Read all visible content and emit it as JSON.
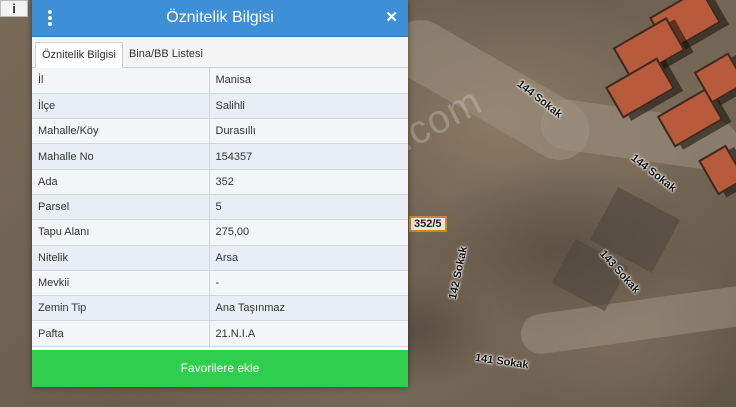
{
  "map": {
    "info_button_label": "i",
    "parcel_label": "352/5",
    "watermark": "emlakjet.com",
    "streets": [
      {
        "label": "144 Sokak"
      },
      {
        "label": "144 Sokak"
      },
      {
        "label": "143 Sokak"
      },
      {
        "label": "142 Sokak"
      },
      {
        "label": "141 Sokak"
      }
    ]
  },
  "dialog": {
    "title": "Öznitelik Bilgisi",
    "menu_icon": "kebab-menu-icon",
    "close_icon": "close-icon",
    "close_glyph": "✕",
    "tabs": [
      {
        "label": "Öznitelik Bilgisi",
        "active": true
      },
      {
        "label": "Bina/BB Listesi",
        "active": false
      }
    ],
    "rows": [
      {
        "key": "İl",
        "value": "Manisa"
      },
      {
        "key": "İlçe",
        "value": "Salihli"
      },
      {
        "key": "Mahalle/Köy",
        "value": "Durasıllı"
      },
      {
        "key": "Mahalle No",
        "value": "154357"
      },
      {
        "key": "Ada",
        "value": "352"
      },
      {
        "key": "Parsel",
        "value": "5"
      },
      {
        "key": "Tapu Alanı",
        "value": "275,00"
      },
      {
        "key": "Nitelik",
        "value": "Arsa"
      },
      {
        "key": "Mevkii",
        "value": "-"
      },
      {
        "key": "Zemin Tip",
        "value": "Ana Taşınmaz"
      },
      {
        "key": "Pafta",
        "value": "21.N.I.A"
      }
    ],
    "favorite_button": "Favorilere ekle"
  },
  "colors": {
    "header": "#3d8fd6",
    "favorite_button": "#2fce4c",
    "parcel_border": "#c48a2c"
  }
}
